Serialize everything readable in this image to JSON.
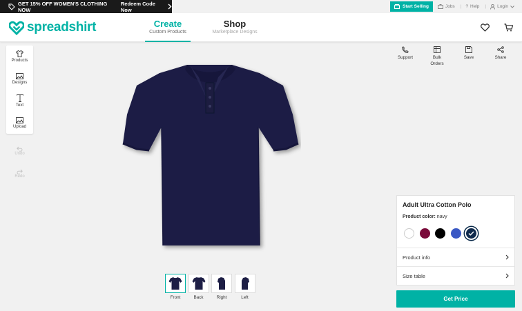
{
  "promo": {
    "text": "GET 15% OFF WOMEN'S CLOTHING NOW",
    "redeem": "Redeem Code Now"
  },
  "util": {
    "start_selling": "Start Selling",
    "jobs": "Jobs",
    "help": "Help",
    "login": "Login"
  },
  "header": {
    "logo": "spreadshirt",
    "tabs": [
      {
        "title": "Create",
        "subtitle": "Custom Products"
      },
      {
        "title": "Shop",
        "subtitle": "Marketplace Designs"
      }
    ]
  },
  "left_tools": [
    {
      "label": "Products",
      "icon": "tshirt-icon"
    },
    {
      "label": "Designs",
      "icon": "image-icon"
    },
    {
      "label": "Text",
      "icon": "text-icon"
    },
    {
      "label": "Upload",
      "icon": "upload-icon"
    }
  ],
  "history": {
    "undo": "Undo",
    "redo": "Redo"
  },
  "right_actions": [
    {
      "label": "Support",
      "icon": "phone-icon"
    },
    {
      "label_line1": "Bulk",
      "label_line2": "Orders",
      "icon": "bulk-icon"
    },
    {
      "label": "Save",
      "icon": "save-icon"
    },
    {
      "label": "Share",
      "icon": "share-icon"
    }
  ],
  "views": [
    {
      "label": "Front"
    },
    {
      "label": "Back"
    },
    {
      "label": "Right"
    },
    {
      "label": "Left"
    }
  ],
  "product": {
    "name": "Adult Ultra Cotton Polo",
    "color_label": "Product color:",
    "color_value": "navy",
    "colors": [
      "#ffffff",
      "#7a0a3a",
      "#000000",
      "#3a58c4",
      "#0f2a4d"
    ],
    "rows": [
      "Product info",
      "Size table"
    ],
    "cta": "Get Price"
  },
  "colors": {
    "accent": "#00b2a5",
    "shirt": "#1d1e45"
  }
}
